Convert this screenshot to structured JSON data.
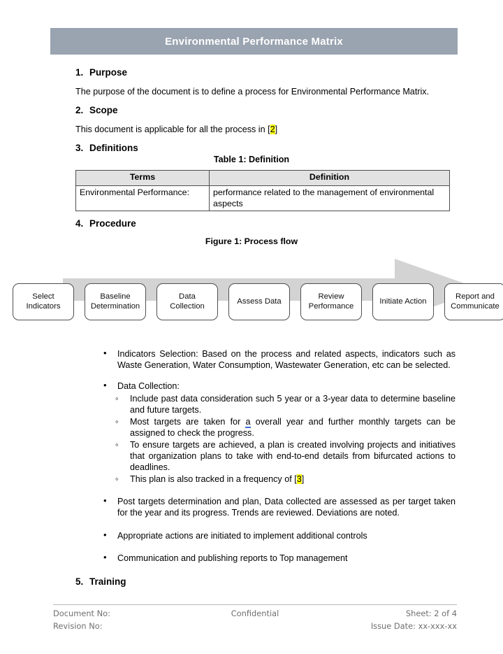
{
  "document": {
    "banner_title": "Environmental Performance Matrix",
    "banner_color": "#9aa3b0"
  },
  "sections": {
    "purpose": {
      "number": "1.",
      "title": "Purpose",
      "body": "The purpose of the document is to define a process for Environmental Performance Matrix."
    },
    "scope": {
      "number": "2.",
      "title": "Scope",
      "body_before": "This document is applicable for all the process in [",
      "highlight": "2",
      "body_after": "]"
    },
    "definitions": {
      "number": "3.",
      "title": "Definitions",
      "table_caption": "Table 1: Definition"
    },
    "procedure": {
      "number": "4.",
      "title": "Procedure",
      "figure_caption": "Figure 1: Process flow"
    },
    "training": {
      "number": "5.",
      "title": "Training"
    }
  },
  "definition_table": {
    "headers": [
      "Terms",
      "Definition"
    ],
    "rows": [
      {
        "term": "Environmental Performance:",
        "definition": "performance related to the management of environmental aspects"
      }
    ]
  },
  "process_flow": {
    "steps": [
      "Select Indicators",
      "Baseline Determination",
      "Data Collection",
      "Assess Data",
      "Review Performance",
      "Initiate Action",
      "Report and Communicate"
    ],
    "step_lines": [
      [
        "Select",
        "Indicators"
      ],
      [
        "Baseline",
        "Determination"
      ],
      [
        "Data",
        "Collection"
      ],
      [
        "Assess Data"
      ],
      [
        "Review",
        "Performance"
      ],
      [
        "Initiate Action"
      ],
      [
        "Report and",
        "Communicate"
      ]
    ],
    "arrow_color": "#d0d0d0"
  },
  "bullets": {
    "indicators_selection": "Indicators Selection: Based on the process and related aspects, indicators such as Waste Generation, Water Consumption, Wastewater Generation, etc can be selected.",
    "data_collection_label": "Data Collection:",
    "data_collection_sub": {
      "item1": "Include past data consideration such 5 year or a 3-year data to determine baseline and future targets.",
      "item2_before": "Most targets are taken for ",
      "item2_spell": "a",
      "item2_after": " overall year and further monthly targets can be assigned to check the progress.",
      "item3": "To ensure targets are achieved, a plan is created involving projects and initiatives that organization plans to take with end-to-end details from bifurcated actions to deadlines.",
      "item4_before": "This plan is also tracked in a frequency of [",
      "item4_highlight": "3",
      "item4_after": "]"
    },
    "post_targets": "Post targets determination and plan, Data collected are assessed as per target taken for the year and its progress. Trends are reviewed. Deviations are noted.",
    "appropriate_actions": "Appropriate actions are initiated to implement additional controls",
    "communication": "Communication and publishing reports to Top management"
  },
  "footer": {
    "document_no": "Document No:",
    "revision_no": "Revision No:",
    "confidential": "Confidential",
    "sheet": "Sheet: 2 of 4",
    "issue_date": "Issue Date: xx-xxx-xx"
  }
}
